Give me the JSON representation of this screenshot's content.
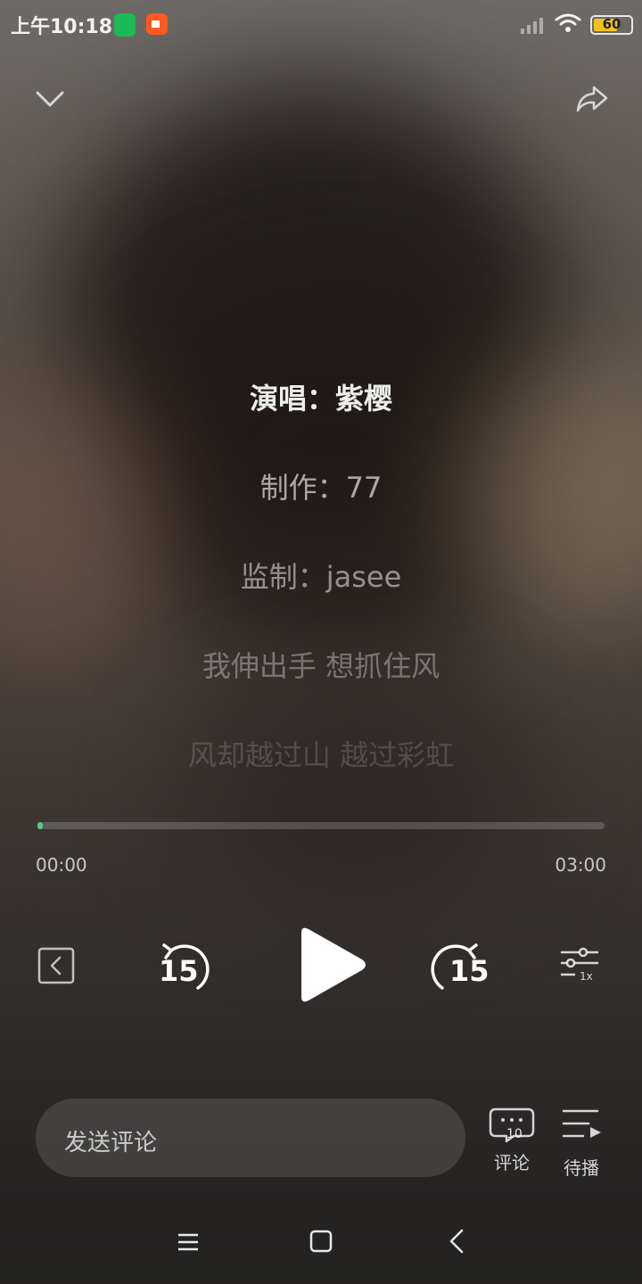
{
  "status_bar": {
    "time": "上午10:18",
    "battery_level": "60",
    "icons": [
      "green-app-icon",
      "orange-video-icon",
      "signal-icon",
      "wifi-icon",
      "battery-icon"
    ]
  },
  "top_bar": {
    "icons": [
      "chevron-down-icon",
      "share-icon"
    ]
  },
  "lyrics": [
    "演唱：紫樱",
    "制作：77",
    "监制：jasee",
    "我伸出手 想抓住风",
    "风却越过山 越过彩虹"
  ],
  "player": {
    "current_time": "00:00",
    "total_time": "03:00",
    "progress": 0.01,
    "rewind_seconds": "15",
    "forward_seconds": "15",
    "speed_label": "1x",
    "accent_color": "#58c98b"
  },
  "bottom_bar": {
    "comment_placeholder": "发送评论",
    "comment_count": "10",
    "comments_label": "评论",
    "queue_label": "待播"
  }
}
